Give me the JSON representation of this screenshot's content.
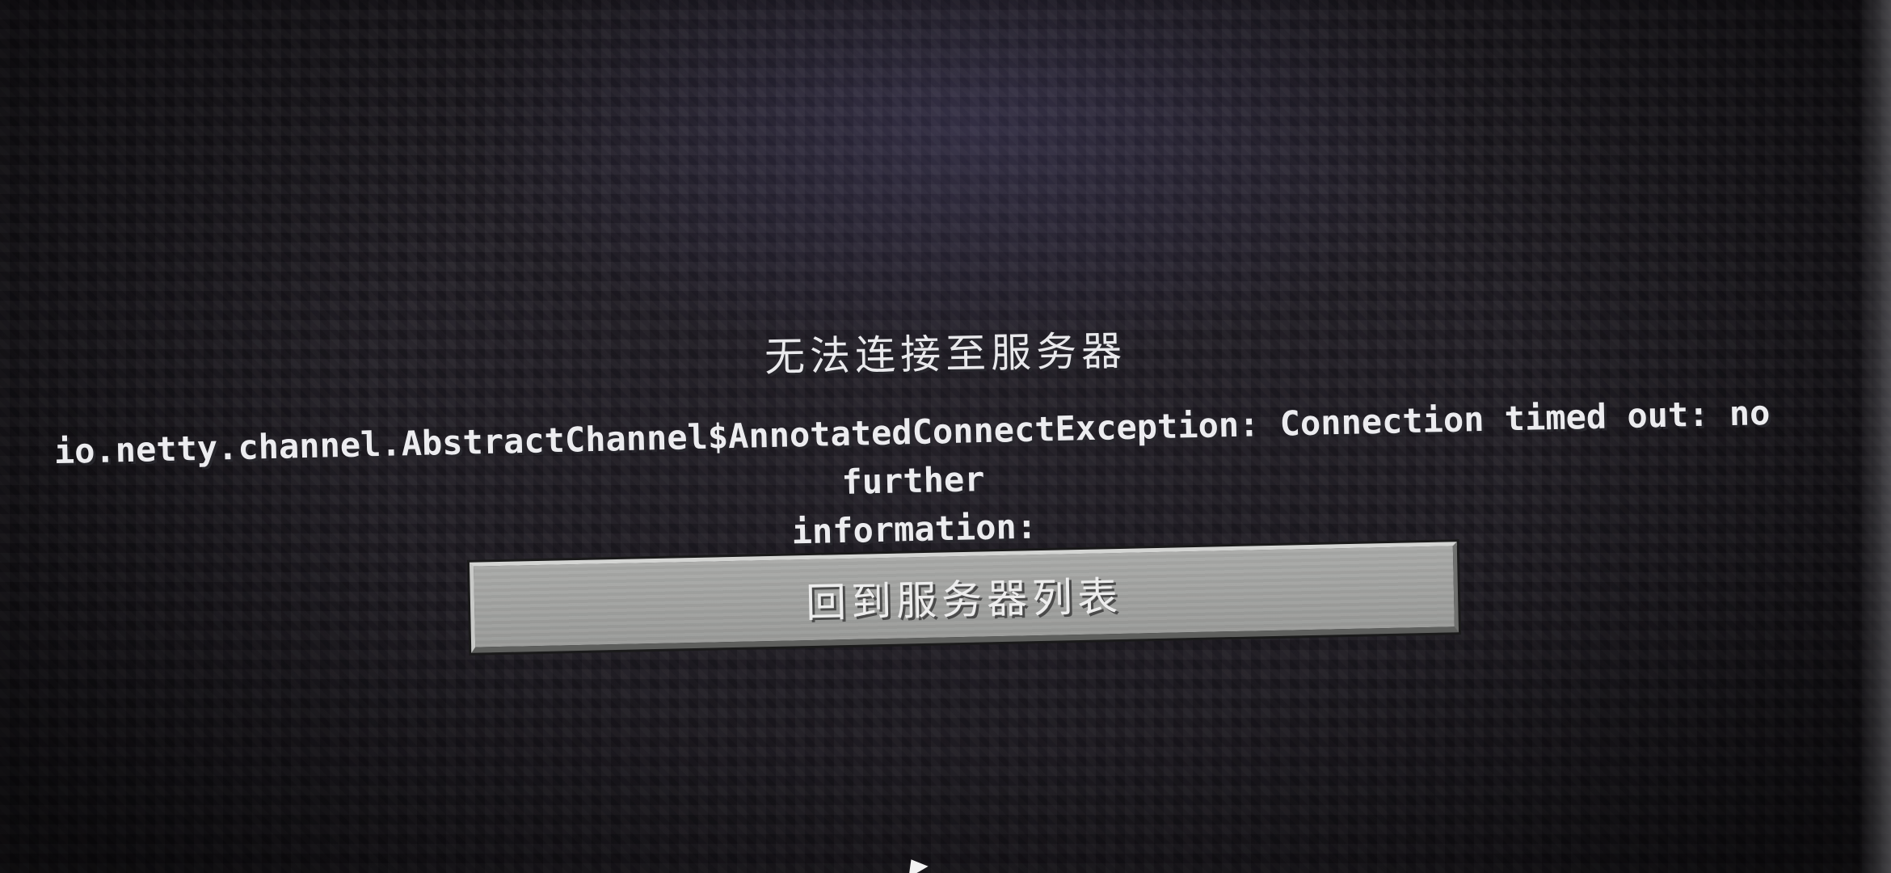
{
  "dialog": {
    "title": "无法连接至服务器",
    "message_line1": "io.netty.channel.AbstractChannel$AnnotatedConnectException: Connection timed out: no further",
    "message_line2": "information:",
    "back_button_label": "回到服务器列表"
  },
  "colors": {
    "background": "#1e1b22",
    "text": "#e9e9ec",
    "button_face": "#a3a4a2",
    "button_text": "#ededed"
  },
  "icons": {
    "cursor": "mouse-pointer-icon"
  }
}
